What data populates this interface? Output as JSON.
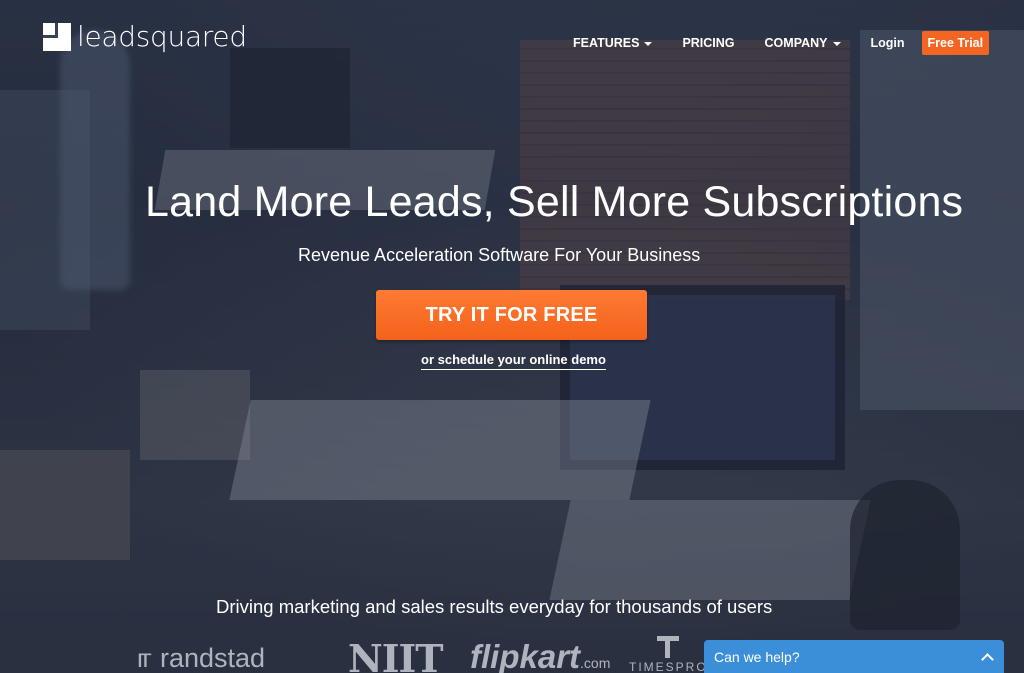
{
  "header": {
    "logo_text": "leadsquared",
    "nav": {
      "features": "FEATURES",
      "pricing": "PRICING",
      "company": "COMPANY",
      "login": "Login",
      "free_trial": "Free Trial"
    }
  },
  "hero": {
    "title": "Land More Leads, Sell More Subscriptions",
    "subtitle": "Revenue Acceleration Software For Your Business",
    "cta_label": "TRY IT FOR FREE",
    "demo_link": "or schedule your online demo"
  },
  "clients": {
    "tagline": "Driving marketing and sales results everyday for thousands of users",
    "logos": {
      "randstad": "randstad",
      "randstad_mark": "гг",
      "niit": "NIIT",
      "flipkart": "flipkart",
      "flipkart_suffix": ".com",
      "timespro": "TIMESPRO"
    }
  },
  "chat": {
    "label": "Can we help?"
  },
  "colors": {
    "accent_orange": "#f26522",
    "chat_blue": "#3b8fd9"
  },
  "icons": {
    "logo": "leadsquared-logo-icon",
    "dropdown": "caret-down-icon",
    "chat_toggle": "chevron-up-icon"
  }
}
